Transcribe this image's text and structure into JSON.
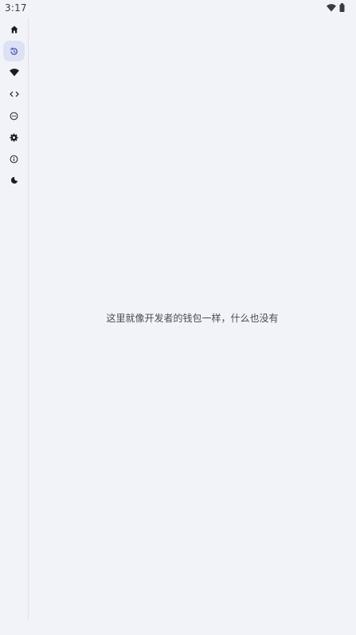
{
  "status_bar": {
    "time": "3:17",
    "icons": [
      "wifi-icon",
      "battery-icon"
    ]
  },
  "nav_rail": {
    "items": [
      {
        "name": "home",
        "icon": "home-icon",
        "active": false
      },
      {
        "name": "history",
        "icon": "history-icon",
        "active": true
      },
      {
        "name": "network",
        "icon": "wifi-icon",
        "active": false
      },
      {
        "name": "code",
        "icon": "code-icon",
        "active": false
      },
      {
        "name": "more",
        "icon": "more-circle-icon",
        "active": false
      },
      {
        "name": "settings",
        "icon": "gear-icon",
        "active": false
      },
      {
        "name": "about",
        "icon": "info-icon",
        "active": false
      },
      {
        "name": "theme",
        "icon": "moon-icon",
        "active": false
      }
    ]
  },
  "main": {
    "empty_message": "这里就像开发者的钱包一样，什么也没有"
  },
  "colors": {
    "background": "#f2f3f8",
    "active_indicator": "#dde1f5",
    "icon": "#1b1b21",
    "active_icon": "#3f4fb0"
  }
}
